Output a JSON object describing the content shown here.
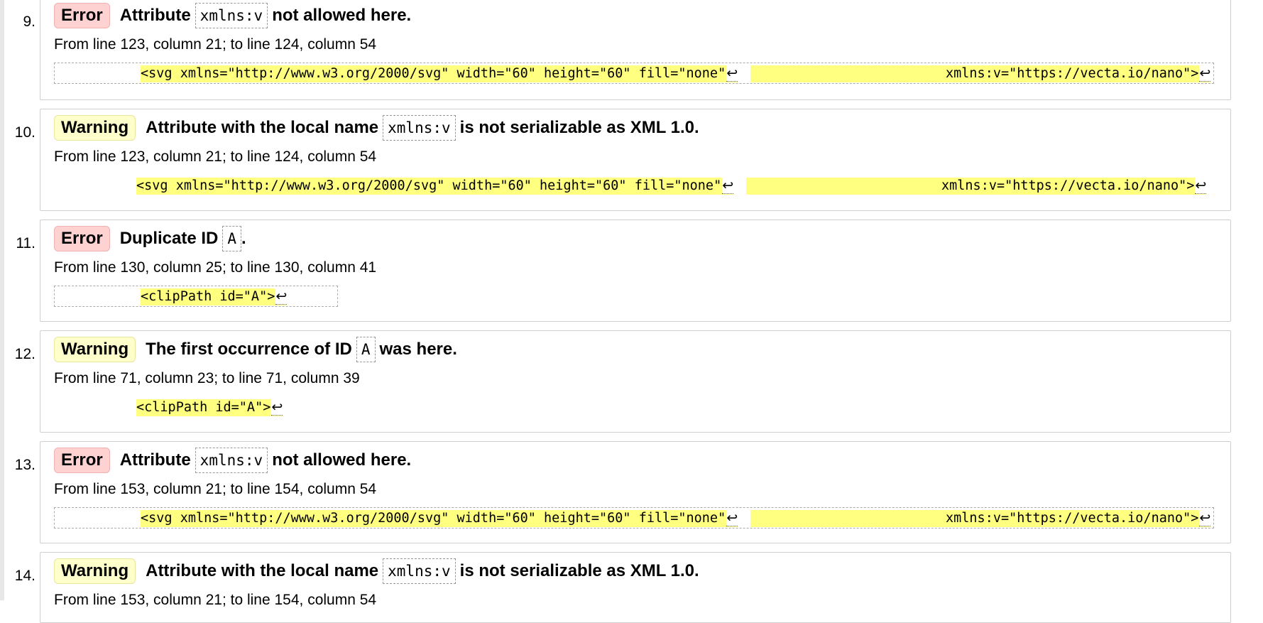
{
  "accent": {
    "error_bg": "#ffd2d2",
    "warning_bg": "#ffffcc",
    "highlight": "#ffff80"
  },
  "return_symbol": "↩",
  "messages": [
    {
      "number": "9.",
      "type": "Error",
      "before": "Attribute",
      "code": "xmlns:v",
      "after": "not allowed here.",
      "location": "From line 123, column 21; to line 124, column 54",
      "extract_left": "<svg xmlns=\"http://www.w3.org/2000/svg\" width=\"60\" height=\"60\" fill=\"none\"",
      "extract_right": "xmlns:v=\"https://vecta.io/nano\">"
    },
    {
      "number": "10.",
      "type": "Warning",
      "before": "Attribute with the local name",
      "code": "xmlns:v",
      "after": "is not serializable as XML 1.0.",
      "location": "From line 123, column 21; to line 124, column 54",
      "extract_left": "<svg xmlns=\"http://www.w3.org/2000/svg\" width=\"60\" height=\"60\" fill=\"none\"",
      "extract_right": "xmlns:v=\"https://vecta.io/nano\">"
    },
    {
      "number": "11.",
      "type": "Error",
      "before": "Duplicate ID",
      "code": "A",
      "after": ".",
      "location": "From line 130, column 25; to line 130, column 41",
      "extract_left": "<clipPath id=\"A\">"
    },
    {
      "number": "12.",
      "type": "Warning",
      "before": "The first occurrence of ID",
      "code": "A",
      "after": "was here.",
      "location": "From line 71, column 23; to line 71, column 39",
      "extract_left": "<clipPath id=\"A\">"
    },
    {
      "number": "13.",
      "type": "Error",
      "before": "Attribute",
      "code": "xmlns:v",
      "after": "not allowed here.",
      "location": "From line 153, column 21; to line 154, column 54",
      "extract_left": "<svg xmlns=\"http://www.w3.org/2000/svg\" width=\"60\" height=\"60\" fill=\"none\"",
      "extract_right": "xmlns:v=\"https://vecta.io/nano\">"
    },
    {
      "number": "14.",
      "type": "Warning",
      "before": "Attribute with the local name",
      "code": "xmlns:v",
      "after": "is not serializable as XML 1.0.",
      "location": "From line 153, column 21; to line 154, column 54"
    }
  ]
}
